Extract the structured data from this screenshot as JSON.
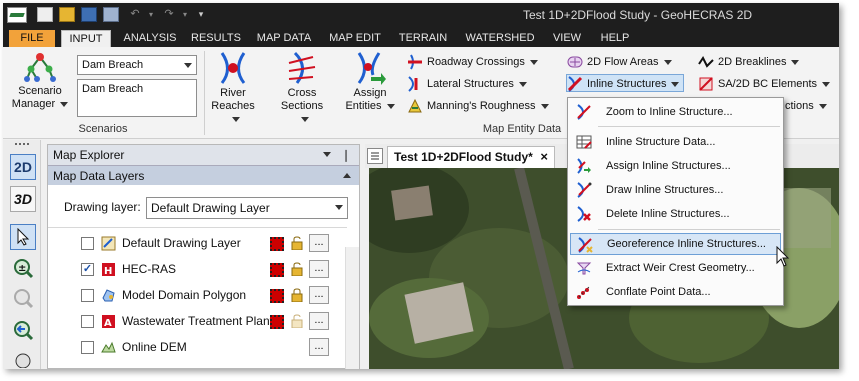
{
  "window": {
    "title": "Test 1D+2DFlood Study - GeoHECRAS 2D"
  },
  "tabs": [
    "FILE",
    "INPUT",
    "ANALYSIS",
    "RESULTS",
    "MAP DATA",
    "MAP EDIT",
    "TERRAIN",
    "WATERSHED",
    "VIEW",
    "HELP"
  ],
  "ribbon": {
    "scenarios": {
      "manager_label_1": "Scenario",
      "manager_label_2": "Manager",
      "combo_value": "Dam Breach",
      "description_value": "Dam Breach",
      "group_label": "Scenarios"
    },
    "map_entity": {
      "river_reaches_1": "River",
      "river_reaches_2": "Reaches",
      "cross_sections_1": "Cross",
      "cross_sections_2": "Sections",
      "assign_entities_1": "Assign",
      "assign_entities_2": "Entities",
      "roadway_crossings": "Roadway Crossings",
      "lateral_structures": "Lateral Structures",
      "mannings_roughness": "Manning's Roughness",
      "flow_areas_2d": "2D Flow Areas",
      "inline_structures": "Inline Structures",
      "breaklines_2d": "2D Breaklines",
      "bc_elements": "SA/2D BC Elements",
      "connections_partial": "ctions",
      "group_label": "Map Entity Data"
    }
  },
  "inline_menu": {
    "items": [
      {
        "label": "Zoom to Inline Structure...",
        "icon": "zoom-icon"
      },
      {
        "label": "Inline Structure Data...",
        "icon": "data-grid-icon"
      },
      {
        "label": "Assign Inline Structures...",
        "icon": "assign-icon"
      },
      {
        "label": "Draw Inline Structures...",
        "icon": "draw-icon"
      },
      {
        "label": "Delete Inline Structures...",
        "icon": "delete-icon"
      },
      {
        "label": "Georeference Inline Structures...",
        "icon": "georeference-icon"
      },
      {
        "label": "Extract Weir Crest Geometry...",
        "icon": "weir-icon"
      },
      {
        "label": "Conflate Point Data...",
        "icon": "conflate-icon"
      }
    ]
  },
  "explorer": {
    "title": "Map Explorer",
    "pin": "❘",
    "subtitle": "Map Data Layers",
    "drawing_layer_label": "Drawing layer:",
    "drawing_layer_value": "Default Drawing Layer",
    "layers": [
      {
        "name": "Default Drawing Layer",
        "checked": false
      },
      {
        "name": "HEC-RAS",
        "checked": true
      },
      {
        "name": "Model Domain Polygon",
        "checked": false
      },
      {
        "name": "Wastewater Treatment Plant",
        "checked": false
      },
      {
        "name": "Online DEM",
        "checked": false
      }
    ],
    "more_label": "..."
  },
  "left_tools": {
    "two_d": "2D",
    "three_d": "3D"
  },
  "document": {
    "tab_label": "Test 1D+2DFlood Study*",
    "close": "×"
  },
  "colors": {
    "title_bar": "#1e1e1e",
    "file_tab": "#f2a23a",
    "menu_hover": "#d7e6f6",
    "accent_red": "#d01020",
    "accent_blue": "#1f5fd0"
  }
}
